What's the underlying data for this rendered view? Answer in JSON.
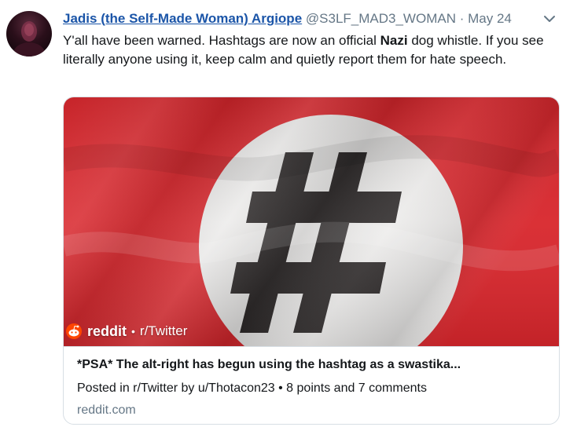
{
  "tweet": {
    "display_name": "Jadis (the Self-Made Woman) Argiope",
    "handle": "@S3LF_MAD3_WOMAN",
    "separator": "·",
    "date": "May 24",
    "text_before": "Y'all have been warned. Hashtags are now an official ",
    "text_bold": "Nazi",
    "text_after": " dog whistle. If you see literally anyone using it, keep calm and quietly report them for hate speech."
  },
  "card": {
    "badge_brand": "reddit",
    "badge_dot": "•",
    "badge_sub": "r/Twitter",
    "title": "*PSA* The alt-right has begun using the hashtag as a swastika...",
    "description": "Posted in r/Twitter by u/Thotacon23 • 8 points and 7 comments",
    "domain": "reddit.com"
  },
  "icons": {
    "caret": "chevron-down-icon",
    "badge": "reddit-alien-icon",
    "image_glyph": "hashtag-icon"
  },
  "colors": {
    "flag_red": "#d8262c",
    "circle_white": "#ecebea",
    "hashtag_black": "#2a2626",
    "link_blue": "#1b55a8",
    "muted": "#657786"
  }
}
